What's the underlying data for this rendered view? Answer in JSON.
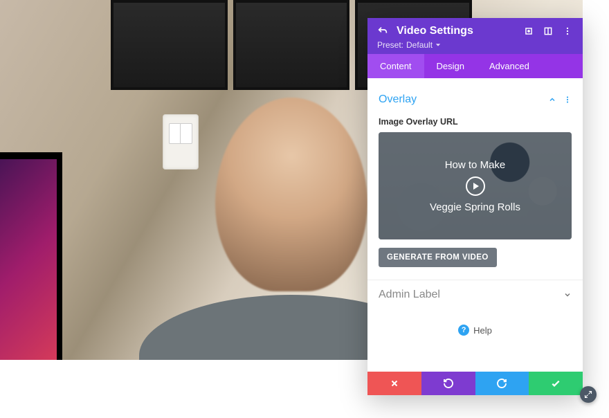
{
  "header": {
    "title": "Video Settings",
    "preset_label": "Preset:",
    "preset_value": "Default"
  },
  "tabs": [
    {
      "label": "Content",
      "active": true
    },
    {
      "label": "Design",
      "active": false
    },
    {
      "label": "Advanced",
      "active": false
    }
  ],
  "overlay_section": {
    "title": "Overlay",
    "field_label": "Image Overlay URL",
    "preview_line1": "How to Make",
    "preview_line2": "Veggie Spring Rolls",
    "generate_button": "GENERATE FROM VIDEO"
  },
  "admin_section": {
    "title": "Admin Label"
  },
  "help": {
    "label": "Help"
  },
  "icons": {
    "undo_arrow": "undo-arrow-icon",
    "expand": "expand-icon",
    "columns": "columns-icon",
    "more_v": "more-vertical-icon",
    "chev_up": "chevron-up-icon",
    "chev_down": "chevron-down-icon",
    "caret_down": "caret-down-icon",
    "play": "play-icon",
    "close_x": "close-icon",
    "reset": "reset-icon",
    "redo": "redo-icon",
    "check": "check-icon",
    "resize": "resize-grip-icon",
    "help": "help-icon"
  }
}
